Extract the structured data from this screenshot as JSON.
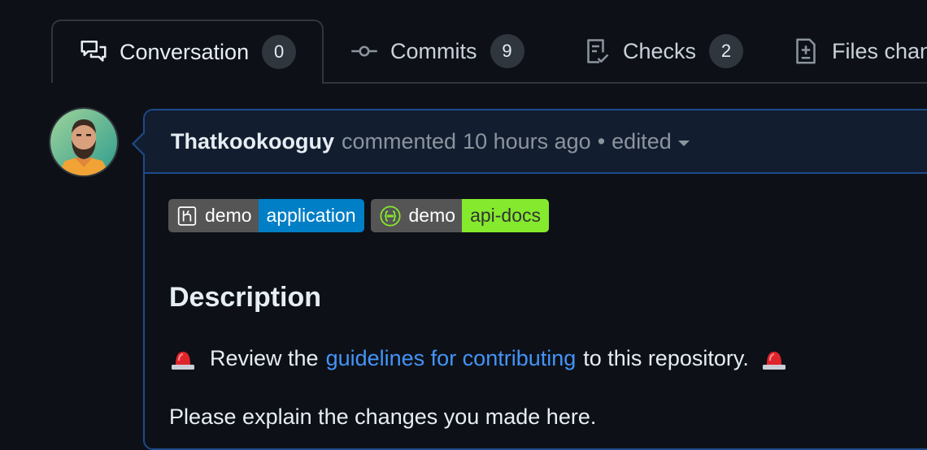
{
  "tabs": [
    {
      "label": "Conversation",
      "count": "0",
      "icon": "comment-discussion-icon"
    },
    {
      "label": "Commits",
      "count": "9",
      "icon": "git-commit-icon"
    },
    {
      "label": "Checks",
      "count": "2",
      "icon": "checklist-icon"
    },
    {
      "label": "Files chan",
      "icon": "file-diff-icon"
    }
  ],
  "comment": {
    "author": "Thatkookooguy",
    "action": "commented",
    "time": "10 hours ago",
    "separator": "•",
    "edited": "edited"
  },
  "badges": [
    {
      "left": "demo",
      "right": "application",
      "right_color": "#007ec6",
      "icon": "heroku-icon"
    },
    {
      "left": "demo",
      "right": "api-docs",
      "right_color": "#85ea2d",
      "icon": "swagger-icon"
    }
  ],
  "body": {
    "heading": "Description",
    "review_prefix": "Review the",
    "review_link": "guidelines for contributing",
    "review_suffix": "to this repository.",
    "explain": "Please explain the changes you made here."
  },
  "colors": {
    "background": "#0d1117",
    "link": "#4493f8",
    "header_bg": "#121d2f",
    "border_accent": "#1f4a8a"
  }
}
